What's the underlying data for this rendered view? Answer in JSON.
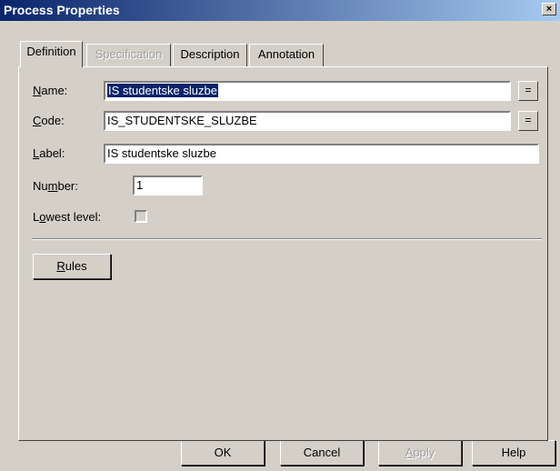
{
  "window": {
    "title": "Process Properties",
    "close_glyph": "×"
  },
  "tabs": [
    {
      "label": "Definition",
      "active": true,
      "enabled": true
    },
    {
      "label": "Specification",
      "active": false,
      "enabled": false
    },
    {
      "label": "Description",
      "active": false,
      "enabled": true
    },
    {
      "label": "Annotation",
      "active": false,
      "enabled": true
    }
  ],
  "form": {
    "name_label_u": "N",
    "name_label_rest": "ame:",
    "name_value": "IS studentske sluzbe",
    "code_label_u": "C",
    "code_label_rest": "ode:",
    "code_value": "IS_STUDENTSKE_SLUZBE",
    "label_label_u": "L",
    "label_label_rest": "abel:",
    "label_value": "IS studentske sluzbe",
    "number_label_pre": "Nu",
    "number_label_u": "m",
    "number_label_rest": "ber:",
    "number_value": "1",
    "lowest_label_pre": "L",
    "lowest_label_u": "o",
    "lowest_label_rest": "west level:",
    "lowest_checked": false,
    "eq_glyph": "="
  },
  "rules_button": {
    "label_u": "R",
    "label_rest": "ules"
  },
  "footer": {
    "ok": "OK",
    "cancel": "Cancel",
    "apply_u": "A",
    "apply_rest": "pply",
    "help": "Help"
  }
}
